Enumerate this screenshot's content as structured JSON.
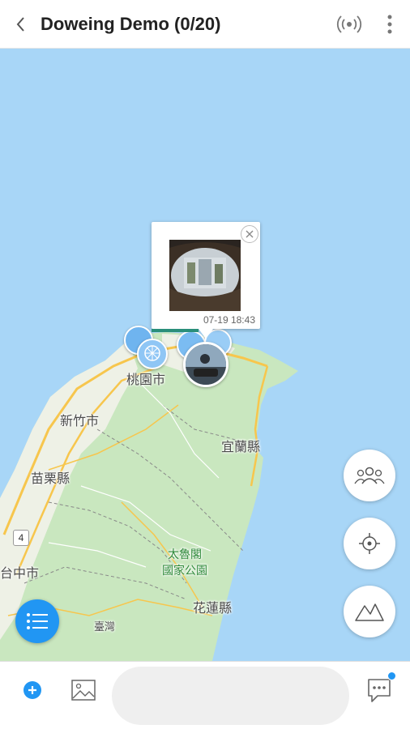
{
  "header": {
    "title": "Doweing Demo (0/20)"
  },
  "map": {
    "places": {
      "taoyuan": "桃園市",
      "hsinchu": "新竹市",
      "yilan": "宜蘭縣",
      "miaoli": "苗栗縣",
      "taichung": "台中市",
      "hualien": "花蓮縣",
      "taiwan": "臺灣",
      "route": "4",
      "park_line1": "太魯閣",
      "park_line2": "國家公園"
    },
    "colors": {
      "sea": "#a8d6f7",
      "land": "#c9e7bf",
      "lowland": "#eef1e6",
      "road": "#f7c64d"
    }
  },
  "popup": {
    "timestamp": "07-19 18:43"
  },
  "bottom": {
    "message_placeholder": ""
  },
  "accent_color": "#2196f3",
  "icons": [
    "back-icon",
    "broadcast-icon",
    "more-icon",
    "close-icon",
    "group-icon",
    "location-target-icon",
    "mountain-icon",
    "list-icon",
    "add-icon",
    "image-icon",
    "chat-icon"
  ]
}
